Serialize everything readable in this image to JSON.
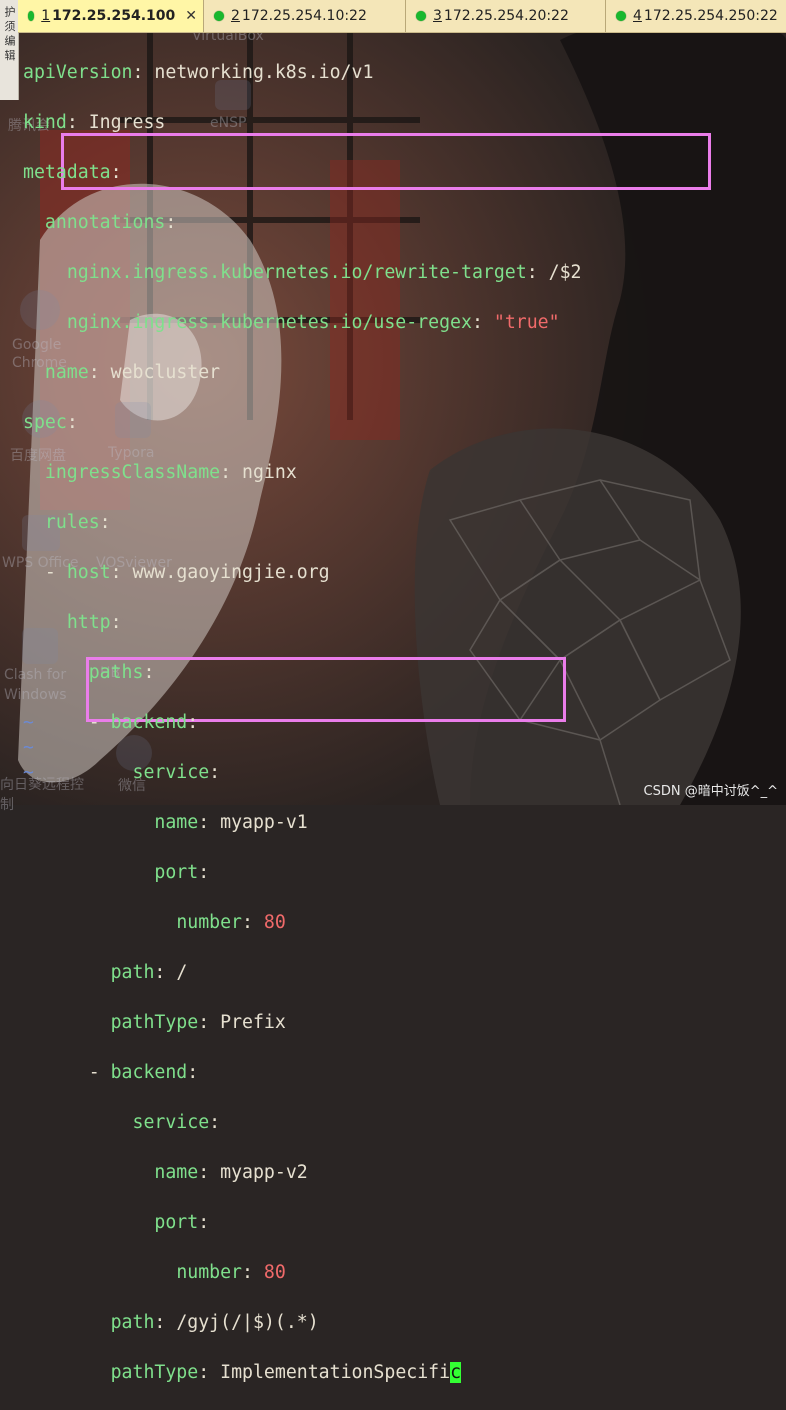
{
  "side_strip": {
    "text": "护 须 编 辑"
  },
  "tabs": [
    {
      "num": "1",
      "label": "172.25.254.100",
      "active": true
    },
    {
      "num": "2",
      "label": "172.25.254.10:22",
      "active": false
    },
    {
      "num": "3",
      "label": "172.25.254.20:22",
      "active": false
    },
    {
      "num": "4",
      "label": "172.25.254.250:22",
      "active": false
    }
  ],
  "desktop_icons": [
    {
      "label": "VirtualBox"
    },
    {
      "label": "eNSP"
    },
    {
      "label": "腾讯会"
    },
    {
      "label": "Google Chrome"
    },
    {
      "label": "百度网盘"
    },
    {
      "label": "Typora"
    },
    {
      "label": "WPS Office"
    },
    {
      "label": "VOSviewer"
    },
    {
      "label": "Clash for Windows"
    },
    {
      "label": "HB"
    },
    {
      "label": "向日葵远程控制"
    },
    {
      "label": "微信"
    }
  ],
  "code": {
    "l1": {
      "key": "apiVersion",
      "val": "networking.k8s.io/v1"
    },
    "l2": {
      "key": "kind",
      "val": "Ingress"
    },
    "l3": {
      "key": "metadata"
    },
    "l4": {
      "key": "annotations"
    },
    "l5": {
      "key": "nginx.ingress.kubernetes.io/rewrite-target",
      "val": "/$2"
    },
    "l6": {
      "key": "nginx.ingress.kubernetes.io/use-regex",
      "val": "\"true\""
    },
    "l7": {
      "key": "name",
      "val": "webcluster"
    },
    "l8": {
      "key": "spec"
    },
    "l9": {
      "key": "ingressClassName",
      "val": "nginx"
    },
    "l10": {
      "key": "rules"
    },
    "l11": {
      "key": "host",
      "val": "www.gaoyingjie.org"
    },
    "l12": {
      "key": "http"
    },
    "l13": {
      "key": "paths"
    },
    "l14": {
      "key": "backend"
    },
    "l15": {
      "key": "service"
    },
    "l16": {
      "key": "name",
      "val": "myapp-v1"
    },
    "l17": {
      "key": "port"
    },
    "l18": {
      "key": "number",
      "val": "80"
    },
    "l19": {
      "key": "path",
      "val": "/"
    },
    "l20": {
      "key": "pathType",
      "val": "Prefix"
    },
    "l21": {
      "key": "backend"
    },
    "l22": {
      "key": "service"
    },
    "l23": {
      "key": "name",
      "val": "myapp-v2"
    },
    "l24": {
      "key": "port"
    },
    "l25": {
      "key": "number",
      "val": "80"
    },
    "l26": {
      "key": "path",
      "val": "/gyj(/|$)(.*)"
    },
    "l27": {
      "key": "pathType",
      "val": "ImplementationSpecifi",
      "cursor_char": "c"
    }
  },
  "tilde": "~",
  "watermark": "CSDN @暗中讨饭^_^",
  "colors": {
    "key": "#7fe08c",
    "value": "#e6e0d0",
    "number": "#f06a6a",
    "highlight_box": "#ea7dea",
    "cursor": "#33ff33",
    "tab_dot": "#19b82e"
  }
}
